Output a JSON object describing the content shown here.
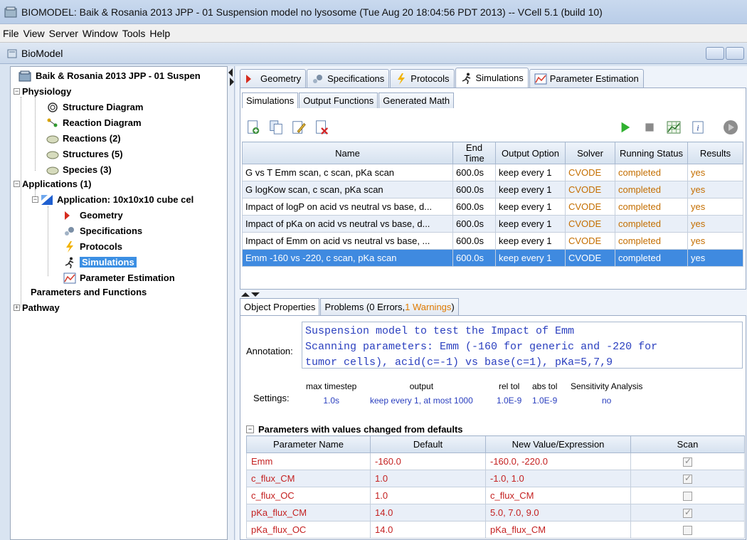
{
  "window": {
    "title": "BIOMODEL: Baik & Rosania 2013 JPP - 01 Suspension model no lysosome (Tue Aug 20 18:04:56 PDT 2013) -- VCell 5.1 (build 10)"
  },
  "menu": [
    "File",
    "View",
    "Server",
    "Window",
    "Tools",
    "Help"
  ],
  "frame": {
    "title": "BioModel"
  },
  "tree": {
    "root": "Baik & Rosania 2013 JPP - 01 Suspen",
    "physiology": "Physiology",
    "structure_diagram": "Structure Diagram",
    "reaction_diagram": "Reaction Diagram",
    "reactions": "Reactions (2)",
    "structures": "Structures (5)",
    "species": "Species (3)",
    "applications": "Applications (1)",
    "application": "Application: 10x10x10 cube cel",
    "geometry": "Geometry",
    "specifications": "Specifications",
    "protocols": "Protocols",
    "simulations": "Simulations",
    "parameter_estimation": "Parameter Estimation",
    "parameters_functions": "Parameters and Functions",
    "pathway": "Pathway"
  },
  "main_tabs": {
    "geometry": "Geometry",
    "specifications": "Specifications",
    "protocols": "Protocols",
    "simulations": "Simulations",
    "parameter_estimation": "Parameter Estimation"
  },
  "sub_tabs": {
    "simulations": "Simulations",
    "output_functions": "Output Functions",
    "generated_math": "Generated Math"
  },
  "sim_table": {
    "headers": [
      "Name",
      "End Time",
      "Output Option",
      "Solver",
      "Running Status",
      "Results"
    ],
    "rows": [
      [
        "G vs T Emm scan, c scan, pKa scan",
        "600.0s",
        "keep every 1",
        "CVODE",
        "completed",
        "yes"
      ],
      [
        "G logKow scan, c scan, pKa scan",
        "600.0s",
        "keep every 1",
        "CVODE",
        "completed",
        "yes"
      ],
      [
        "Impact of logP on acid vs neutral vs base, d...",
        "600.0s",
        "keep every 1",
        "CVODE",
        "completed",
        "yes"
      ],
      [
        "Impact of pKa on acid vs neutral vs base, d...",
        "600.0s",
        "keep every 1",
        "CVODE",
        "completed",
        "yes"
      ],
      [
        "Impact of Emm on acid vs neutral vs base, ...",
        "600.0s",
        "keep every 1",
        "CVODE",
        "completed",
        "yes"
      ],
      [
        "Emm -160 vs -220, c scan, pKa scan",
        "600.0s",
        "keep every 1",
        "CVODE",
        "completed",
        "yes"
      ]
    ]
  },
  "props_tabs": {
    "object_properties": "Object Properties",
    "problems_prefix": "Problems (0 Errors, ",
    "problems_warnings": "1 Warnings",
    "problems_suffix": ")"
  },
  "annotation": {
    "label": "Annotation:",
    "line1": "Suspension model to test the Impact of Emm",
    "line2": "Scanning parameters: Emm (-160 for generic and -220 for",
    "line3": "tumor cells), acid(c=-1) vs base(c=1), pKa=5,7,9"
  },
  "settings": {
    "label": "Settings:",
    "max_timestep_h": "max timestep",
    "max_timestep_v": "1.0s",
    "output_h": "output",
    "output_v": "keep every 1, at most 1000",
    "rel_tol_h": "rel tol",
    "rel_tol_v": "1.0E-9",
    "abs_tol_h": "abs tol",
    "abs_tol_v": "1.0E-9",
    "sens_h": "Sensitivity Analysis",
    "sens_v": "no"
  },
  "params": {
    "title": "Parameters with values changed from defaults",
    "headers": [
      "Parameter Name",
      "Default",
      "New Value/Expression",
      "Scan"
    ],
    "rows": [
      {
        "name": "Emm",
        "default": "-160.0",
        "new": "-160.0, -220.0",
        "scan": true
      },
      {
        "name": "c_flux_CM",
        "default": "1.0",
        "new": "-1.0, 1.0",
        "scan": true
      },
      {
        "name": "c_flux_OC",
        "default": "1.0",
        "new": "c_flux_CM",
        "scan": false
      },
      {
        "name": "pKa_flux_CM",
        "default": "14.0",
        "new": "5.0, 7.0, 9.0",
        "scan": true
      },
      {
        "name": "pKa_flux_OC",
        "default": "14.0",
        "new": "pKa_flux_CM",
        "scan": false
      }
    ]
  },
  "colors": {
    "selection": "#3f8ae0",
    "status_orange": "#c46e00",
    "annotation_blue": "#2a3fbf",
    "param_red": "#c42121"
  },
  "icons": {
    "geometry": "geometry-icon",
    "specifications": "gears-icon",
    "protocols": "lightning-icon",
    "simulations": "running-man-icon",
    "parameter_estimation": "chart-icon"
  }
}
